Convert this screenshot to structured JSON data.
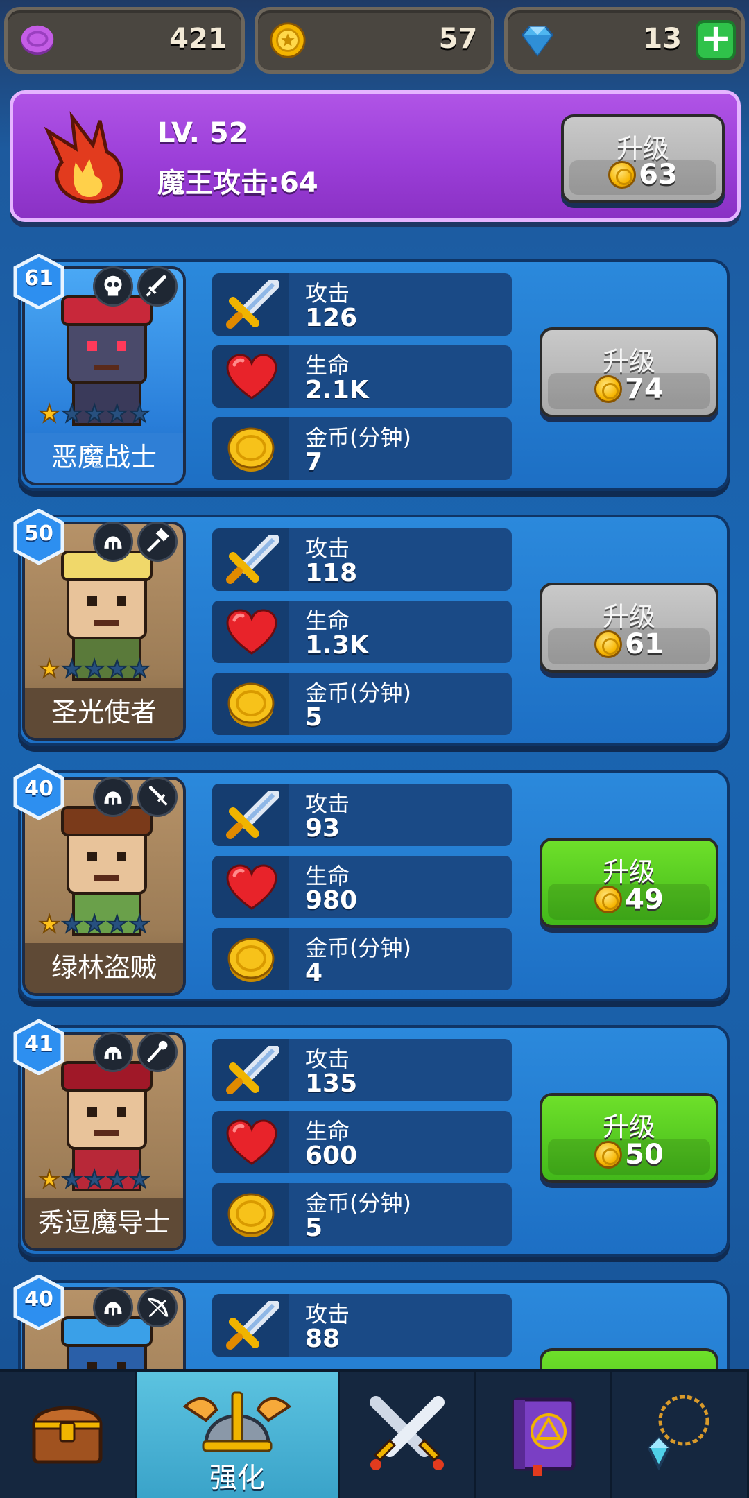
{
  "resources": {
    "gems": "421",
    "coins": "57",
    "diamonds": "13",
    "plus_label": "+"
  },
  "boss": {
    "level": "LV. 52",
    "attack": "魔王攻击:64",
    "upgrade_label": "升级",
    "upgrade_cost": "63"
  },
  "stat_labels": {
    "attack": "攻击",
    "hp": "生命",
    "gold": "金币(分钟)"
  },
  "heroes": [
    {
      "level": "61",
      "name": "恶魔战士",
      "stars": 1,
      "attack": "126",
      "hp": "2.1K",
      "gold": "7",
      "upgrade_label": "升级",
      "cost": "74",
      "affordable": false,
      "color": "#3a8ee8",
      "icons": [
        "skull-icon",
        "sword-icon"
      ]
    },
    {
      "level": "50",
      "name": "圣光使者",
      "stars": 1,
      "attack": "118",
      "hp": "1.3K",
      "gold": "5",
      "upgrade_label": "升级",
      "cost": "61",
      "affordable": false,
      "color": "#9c7c56",
      "icons": [
        "helmet-icon",
        "hammer-icon"
      ]
    },
    {
      "level": "40",
      "name": "绿林盗贼",
      "stars": 1,
      "attack": "93",
      "hp": "980",
      "gold": "4",
      "upgrade_label": "升级",
      "cost": "49",
      "affordable": true,
      "color": "#9c7c56",
      "icons": [
        "helmet-icon",
        "dagger-icon"
      ]
    },
    {
      "level": "41",
      "name": "秀逗魔导士",
      "stars": 1,
      "attack": "135",
      "hp": "600",
      "gold": "5",
      "upgrade_label": "升级",
      "cost": "50",
      "affordable": true,
      "color": "#9c7c56",
      "icons": [
        "helmet-icon",
        "staff-icon"
      ]
    },
    {
      "level": "40",
      "name": "",
      "stars": 1,
      "attack": "88",
      "hp": "",
      "gold": "",
      "upgrade_label": "",
      "cost": "",
      "affordable": true,
      "color": "#9c7c56",
      "icons": [
        "helmet-icon",
        "bow-icon"
      ]
    }
  ],
  "nav": {
    "tabs": [
      {
        "name": "chest",
        "label": ""
      },
      {
        "name": "upgrade",
        "label": "强化"
      },
      {
        "name": "battle",
        "label": ""
      },
      {
        "name": "spellbook",
        "label": ""
      },
      {
        "name": "amulet",
        "label": ""
      }
    ]
  }
}
